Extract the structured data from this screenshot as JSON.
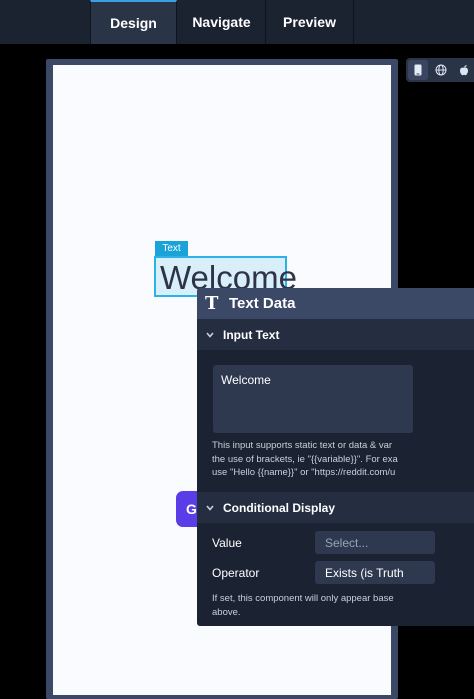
{
  "tabs": [
    {
      "label": "Design",
      "active": true
    },
    {
      "label": "Navigate",
      "active": false
    },
    {
      "label": "Preview",
      "active": false
    }
  ],
  "device_toggle": {
    "icons": [
      "phone-icon",
      "globe-icon",
      "apple-icon"
    ],
    "selected": "phone-icon"
  },
  "canvas": {
    "selected_component_badge": "Text",
    "welcome_text": "Welcome",
    "partial_button_label": "G"
  },
  "panel": {
    "title": "Text Data",
    "input_section": {
      "title": "Input Text",
      "value": "Welcome",
      "help_lines": [
        "This input supports static text or data & var",
        "the use of brackets, ie \"{{variable}}\". For exa",
        "use \"Hello {{name}}\" or \"https://reddit.com/u"
      ]
    },
    "conditional_section": {
      "title": "Conditional Display",
      "value_label": "Value",
      "value_placeholder": "Select...",
      "operator_label": "Operator",
      "operator_value": "Exists (is Truth",
      "help_lines": [
        "If set, this component will only appear base",
        "above."
      ]
    }
  },
  "colors": {
    "accent": "#2bb3e8",
    "topbar": "#1b2230",
    "panel": "#1b2231",
    "panel_header": "#3c4966",
    "purple": "#5b3de8"
  }
}
